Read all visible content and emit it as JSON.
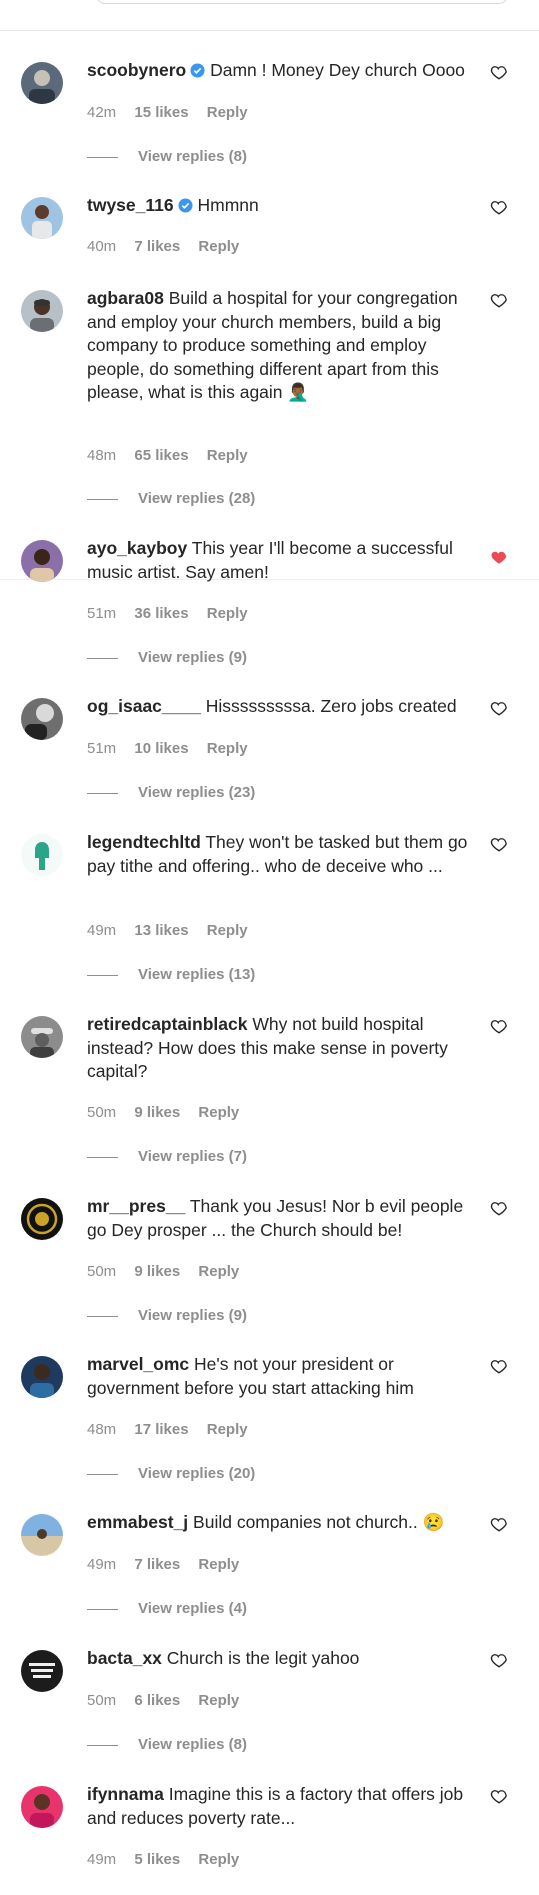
{
  "comments": [
    {
      "username": "scoobynero",
      "verified": true,
      "text": "Damn ! Money Dey church Oooo",
      "time": "42m",
      "likes": "15 likes",
      "reply": "Reply",
      "view_replies": "View replies (8)",
      "liked": false
    },
    {
      "username": "twyse_116",
      "verified": true,
      "text": "Hmmnn",
      "time": "40m",
      "likes": "7 likes",
      "reply": "Reply",
      "view_replies": "",
      "liked": false
    },
    {
      "username": "agbara08",
      "verified": false,
      "text": "Build a hospital for your congregation and employ your church members, build a big company to produce something and employ people, do something different apart from this please, what is this again 🤦🏾‍♂️",
      "time": "48m",
      "likes": "65 likes",
      "reply": "Reply",
      "view_replies": "View replies (28)",
      "liked": false
    },
    {
      "username": "ayo_kayboy",
      "verified": false,
      "text": "This year I'll become a successful music artist. Say amen!",
      "time": "51m",
      "likes": "36 likes",
      "reply": "Reply",
      "view_replies": "View replies (9)",
      "liked": true
    },
    {
      "username": "og_isaac____",
      "verified": false,
      "text": "Hisssssssssa. Zero jobs created",
      "time": "51m",
      "likes": "10 likes",
      "reply": "Reply",
      "view_replies": "View replies (23)",
      "liked": false
    },
    {
      "username": "legendtechltd",
      "verified": false,
      "text": "They won't be tasked but them go pay tithe and offering.. who de deceive who ...",
      "time": "49m",
      "likes": "13 likes",
      "reply": "Reply",
      "view_replies": "View replies (13)",
      "liked": false
    },
    {
      "username": "retiredcaptainblack",
      "verified": false,
      "text": "Why not build hospital instead? How does this make sense in poverty capital?",
      "time": "50m",
      "likes": "9 likes",
      "reply": "Reply",
      "view_replies": "View replies (7)",
      "liked": false
    },
    {
      "username": "mr__pres__",
      "verified": false,
      "text": "Thank you Jesus! Nor b evil people go Dey prosper ... the Church should be!",
      "time": "50m",
      "likes": "9 likes",
      "reply": "Reply",
      "view_replies": "View replies (9)",
      "liked": false
    },
    {
      "username": "marvel_omc",
      "verified": false,
      "text": "He's not your president or government before you start attacking him",
      "time": "48m",
      "likes": "17 likes",
      "reply": "Reply",
      "view_replies": "View replies (20)",
      "liked": false
    },
    {
      "username": "emmabest_j",
      "verified": false,
      "text": "Build companies not church.. 😢",
      "time": "49m",
      "likes": "7 likes",
      "reply": "Reply",
      "view_replies": "View replies (4)",
      "liked": false
    },
    {
      "username": "bacta_xx",
      "verified": false,
      "text": "Church is the legit yahoo",
      "time": "50m",
      "likes": "6 likes",
      "reply": "Reply",
      "view_replies": "View replies (8)",
      "liked": false
    },
    {
      "username": "ifynnama",
      "verified": false,
      "text": "Imagine this is a factory that offers job and reduces poverty rate...",
      "time": "49m",
      "likes": "5 likes",
      "reply": "Reply",
      "view_replies": "",
      "liked": false
    }
  ],
  "icons": {
    "heart": "heart-outline-icon",
    "heart_liked": "heart-filled-icon",
    "verified": "verified-badge-icon"
  },
  "colors": {
    "text": "#262626",
    "secondary": "#8e8e8e",
    "liked_heart": "#ed4956",
    "verified": "#3897f0"
  }
}
